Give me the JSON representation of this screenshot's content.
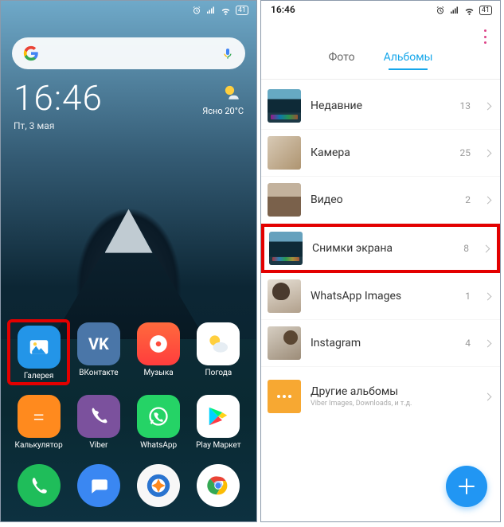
{
  "left": {
    "status": {
      "battery": "41"
    },
    "clock": "16:46",
    "date": "Пт, 3 мая",
    "weather_label": "Ясно",
    "weather_temp": "20°C",
    "apps_row1": [
      {
        "label": "Галерея"
      },
      {
        "label": "ВКонтакте"
      },
      {
        "label": "Музыка"
      },
      {
        "label": "Погода"
      }
    ],
    "apps_row2": [
      {
        "label": "Калькулятор"
      },
      {
        "label": "Viber"
      },
      {
        "label": "WhatsApp"
      },
      {
        "label": "Play Маркет"
      }
    ]
  },
  "right": {
    "time": "16:46",
    "status": {
      "battery": "41"
    },
    "tabs": {
      "photos": "Фото",
      "albums": "Альбомы"
    },
    "albums": [
      {
        "name": "Недавние",
        "count": "13"
      },
      {
        "name": "Камера",
        "count": "25"
      },
      {
        "name": "Видео",
        "count": "2"
      },
      {
        "name": "Снимки экрана",
        "count": "8"
      },
      {
        "name": "WhatsApp Images",
        "count": "1"
      },
      {
        "name": "Instagram",
        "count": "4"
      }
    ],
    "other": {
      "title": "Другие альбомы",
      "sub": "Viber Images, Downloads, и т.д."
    }
  }
}
